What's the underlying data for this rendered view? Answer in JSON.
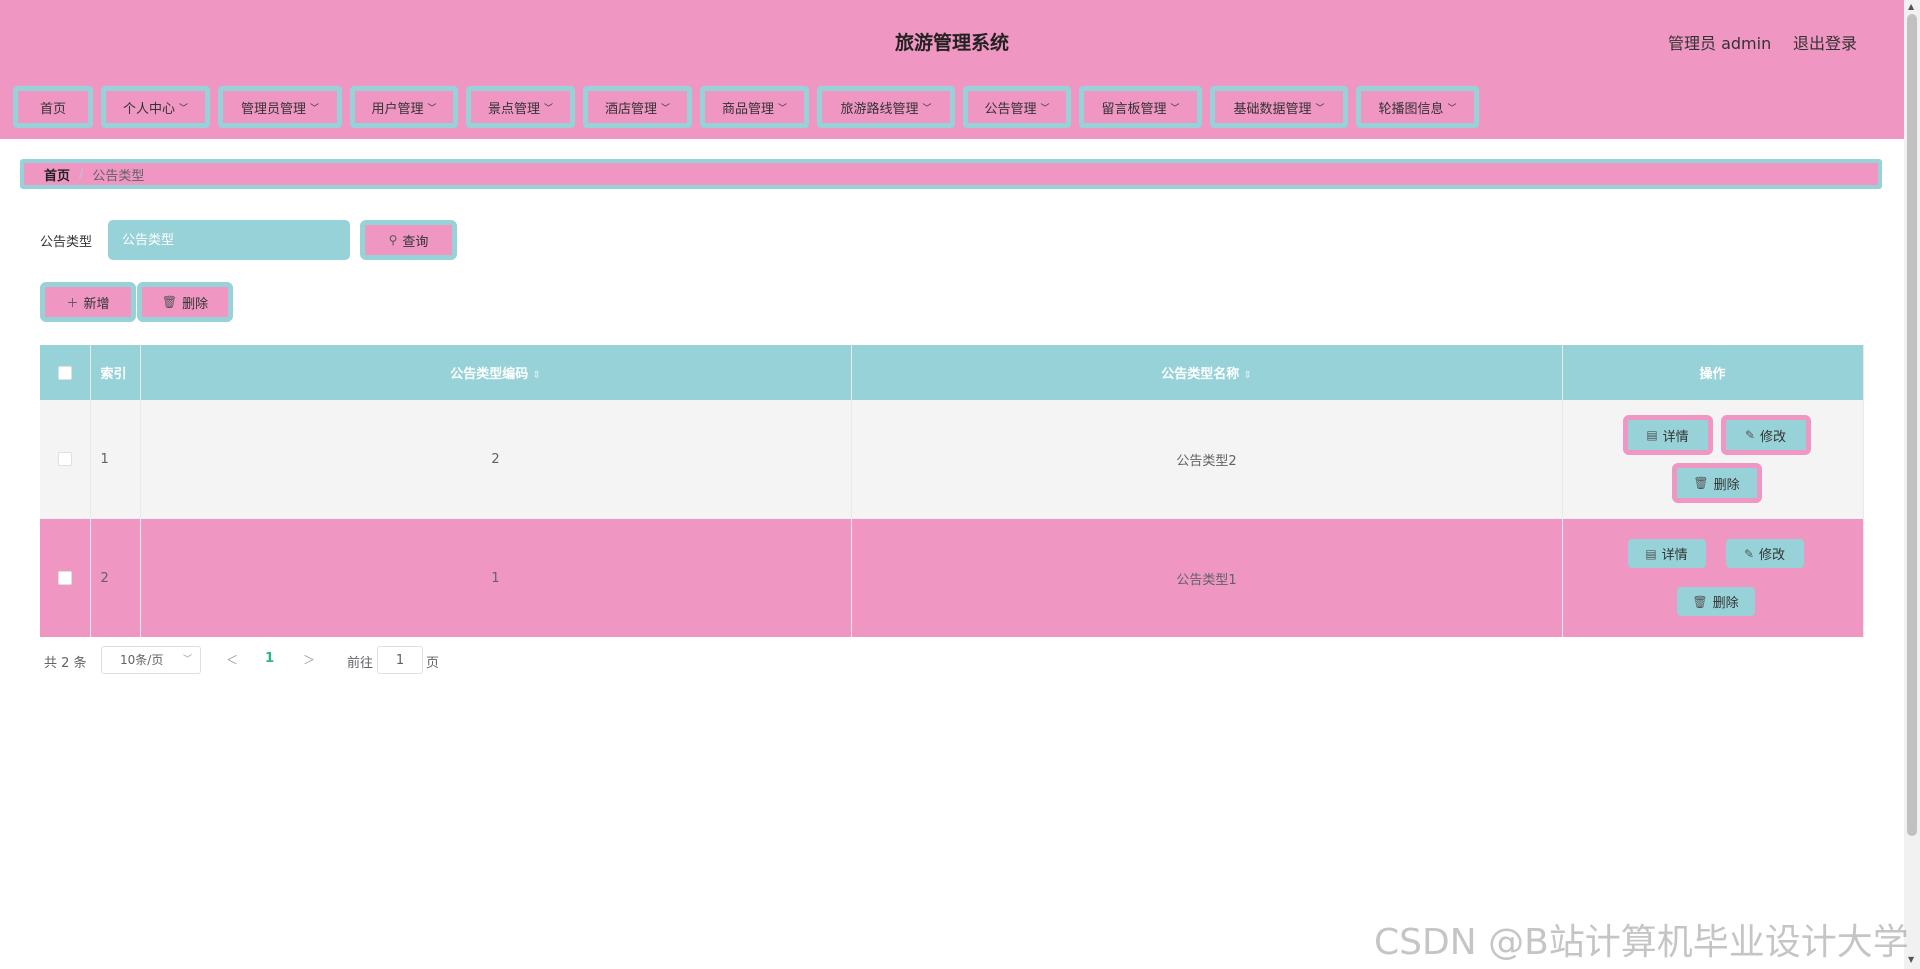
{
  "header": {
    "title": "旅游管理系统",
    "user": "管理员 admin",
    "logout": "退出登录"
  },
  "nav": [
    {
      "label": "首页",
      "chevron": false
    },
    {
      "label": "个人中心",
      "chevron": true
    },
    {
      "label": "管理员管理",
      "chevron": true
    },
    {
      "label": "用户管理",
      "chevron": true
    },
    {
      "label": "景点管理",
      "chevron": true
    },
    {
      "label": "酒店管理",
      "chevron": true
    },
    {
      "label": "商品管理",
      "chevron": true
    },
    {
      "label": "旅游路线管理",
      "chevron": true
    },
    {
      "label": "公告管理",
      "chevron": true
    },
    {
      "label": "留言板管理",
      "chevron": true
    },
    {
      "label": "基础数据管理",
      "chevron": true
    },
    {
      "label": "轮播图信息",
      "chevron": true
    }
  ],
  "breadcrumb": {
    "home": "首页",
    "separator": "/",
    "current": "公告类型"
  },
  "search": {
    "label": "公告类型",
    "placeholder": "公告类型",
    "value": "",
    "button": "查询"
  },
  "actions": {
    "add": "新增",
    "delete": "删除"
  },
  "table": {
    "columns": [
      "索引",
      "公告类型编码",
      "公告类型名称",
      "操作"
    ],
    "sortable": [
      false,
      true,
      true,
      false
    ],
    "rows": [
      {
        "index": "1",
        "code": "2",
        "name": "公告类型2"
      },
      {
        "index": "2",
        "code": "1",
        "name": "公告类型1"
      }
    ],
    "row_actions": {
      "detail": "详情",
      "edit": "修改",
      "delete": "删除"
    }
  },
  "pagination": {
    "total": "共 2 条",
    "page_size": "10条/页",
    "current_page": "1",
    "goto_label": "前往",
    "goto_value": "1",
    "page_suffix": "页"
  },
  "watermark": "CSDN @B站计算机毕业设计大学",
  "colors": {
    "pink": "#f096c3",
    "teal": "#96d2d8",
    "active_page": "#2bb68e"
  },
  "icons": [
    "search-icon",
    "plus-icon",
    "trash-icon",
    "document-icon",
    "edit-icon",
    "chevron-down-icon",
    "chevron-left-icon",
    "chevron-right-icon"
  ]
}
